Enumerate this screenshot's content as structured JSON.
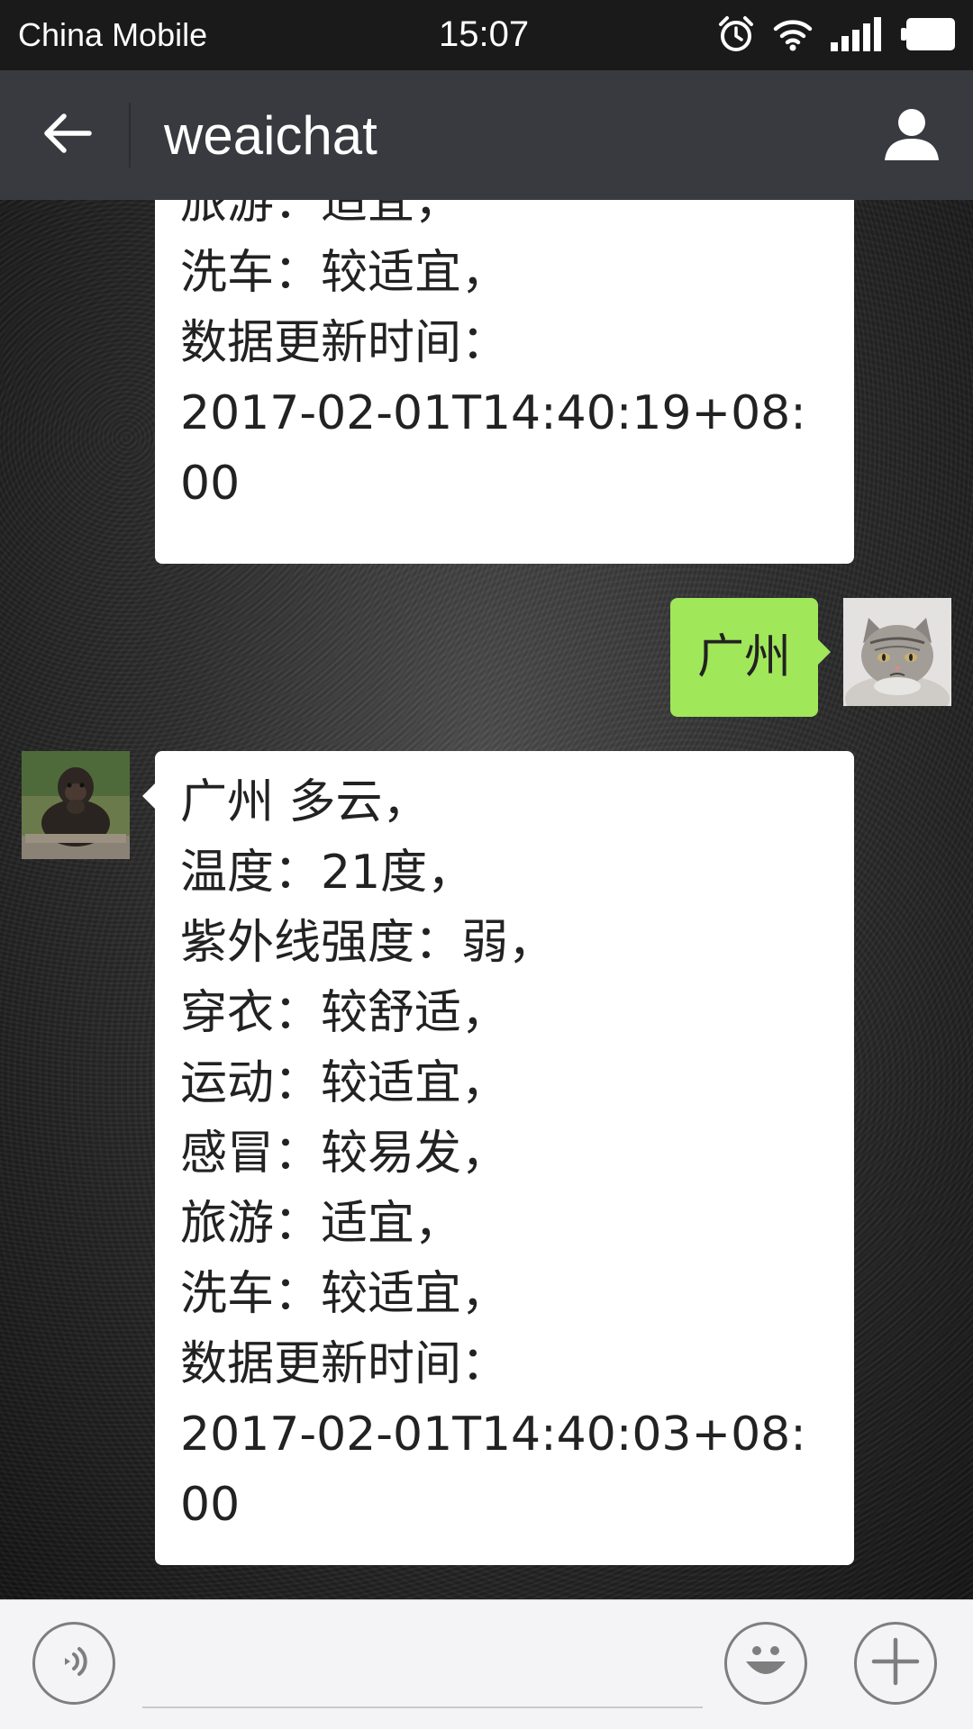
{
  "status_bar": {
    "carrier": "China Mobile",
    "time": "15:07",
    "icons": [
      "alarm-icon",
      "wifi-icon",
      "signal-icon",
      "battery-icon"
    ]
  },
  "header": {
    "title": "weaichat",
    "back_icon": "arrow-left-icon",
    "profile_icon": "person-icon"
  },
  "messages": [
    {
      "sender": "bot",
      "lines": [
        "旅游：适宜，",
        "洗车：较适宜，",
        "数据更新时间：",
        "2017-02-01T14:40:19+08:",
        "00"
      ]
    },
    {
      "sender": "user",
      "lines": [
        "广州"
      ]
    },
    {
      "sender": "bot",
      "lines": [
        "广州 多云，",
        "温度：21度，",
        "紫外线强度：弱，",
        "穿衣：较舒适，",
        "运动：较适宜，",
        "感冒：较易发，",
        "旅游：适宜，",
        "洗车：较适宜，",
        "数据更新时间：",
        "2017-02-01T14:40:03+08:",
        "00"
      ]
    }
  ],
  "input_bar": {
    "voice_icon": "voice-icon",
    "emoji_icon": "emoji-icon",
    "plus_icon": "plus-icon",
    "input_value": ""
  },
  "colors": {
    "header_bg": "#393a3f",
    "status_bg": "#1a1a1a",
    "user_bubble": "#a0e75a",
    "bot_bubble": "#ffffff"
  }
}
